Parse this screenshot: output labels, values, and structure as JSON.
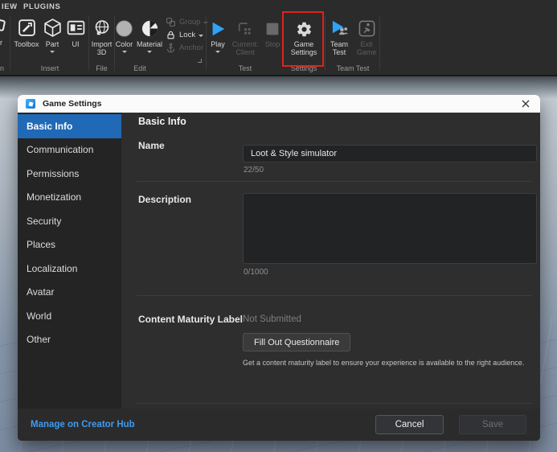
{
  "colors": {
    "selected_blue": "#2069B6",
    "highlight_red": "#DE231C",
    "link_blue": "#3F9BF0",
    "play_blue": "#2FA2F8"
  },
  "ribbon": {
    "tabs": [
      {
        "label": "IEW"
      },
      {
        "label": "PLUGINS"
      }
    ],
    "clipped": {
      "item_label": "r",
      "section_label": "n"
    },
    "insert": {
      "section_label": "Insert",
      "toolbox_label": "Toolbox",
      "part_label": "Part",
      "ui_label": "UI"
    },
    "file": {
      "section_label": "File",
      "import_label": "Import 3D"
    },
    "edit": {
      "section_label": "Edit",
      "color_label": "Color",
      "material_label": "Material",
      "group_label": "Group",
      "lock_label": "Lock",
      "anchor_label": "Anchor"
    },
    "test": {
      "section_label": "Test",
      "play_label": "Play",
      "current_client_label": "Current: Client",
      "stop_label": "Stop"
    },
    "settings": {
      "section_label": "Settings",
      "game_settings_label": "Game Settings"
    },
    "team_test": {
      "section_label": "Team Test",
      "team_test_label": "Team Test",
      "exit_game_label": "Exit Game"
    }
  },
  "dialog": {
    "title": "Game Settings",
    "sidebar": {
      "items": [
        {
          "label": "Basic Info",
          "selected": true
        },
        {
          "label": "Communication"
        },
        {
          "label": "Permissions"
        },
        {
          "label": "Monetization"
        },
        {
          "label": "Security"
        },
        {
          "label": "Places"
        },
        {
          "label": "Localization"
        },
        {
          "label": "Avatar"
        },
        {
          "label": "World"
        },
        {
          "label": "Other"
        }
      ]
    },
    "content": {
      "heading": "Basic Info",
      "name_label": "Name",
      "name_value": "Loot & Style simulator",
      "name_counter": "22/50",
      "description_label": "Description",
      "description_value": "",
      "description_counter": "0/1000",
      "maturity_label": "Content Maturity Label",
      "maturity_status": "Not Submitted",
      "questionnaire_button": "Fill Out Questionnaire",
      "maturity_help": "Get a content maturity label to ensure your experience is available to the right audience."
    },
    "footer": {
      "link": "Manage on Creator Hub",
      "cancel": "Cancel",
      "save": "Save"
    }
  }
}
